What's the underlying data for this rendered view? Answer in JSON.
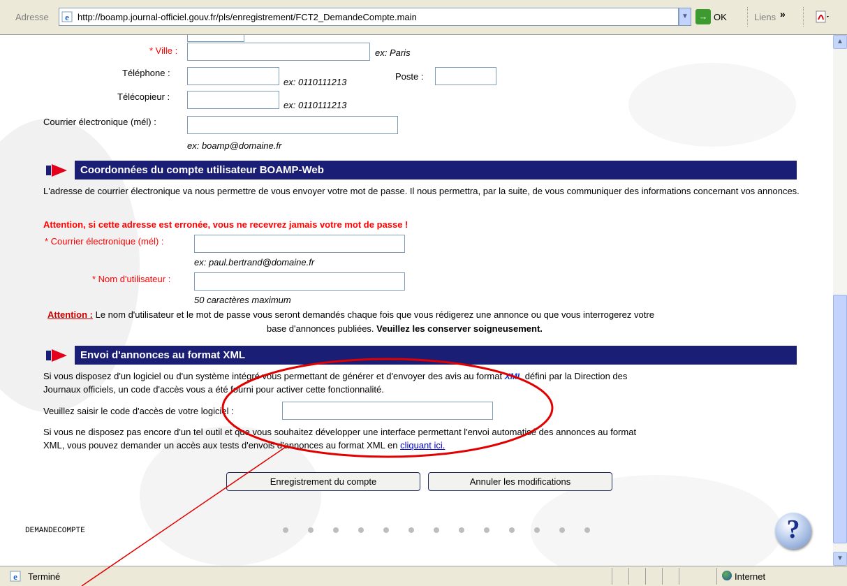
{
  "browser": {
    "address_label": "Adresse",
    "url": "http://boamp.journal-officiel.gouv.fr/pls/enregistrement/FCT2_DemandeCompte.main",
    "go_label": "OK",
    "links_label": "Liens",
    "links_chevron": "»",
    "status_text": "Terminé",
    "zone_text": "Internet"
  },
  "address_section": {
    "ville_label": "* Ville :",
    "ville_example": "ex: Paris",
    "telephone_label": "Téléphone :",
    "telephone_example": "ex: 0110111213",
    "poste_label": "Poste :",
    "telecopieur_label": "Télécopieur :",
    "telecopieur_example": "ex: 0110111213",
    "mel_label": "Courrier électronique (mél) :",
    "mel_example": "ex: boamp@domaine.fr"
  },
  "account_section": {
    "title": "Coordonnées du compte utilisateur BOAMP-Web",
    "intro": "L'adresse de courrier électronique va nous permettre de vous envoyer votre mot de passe. Il nous permettra, par la suite, de vous communiquer des informations concernant vos annonces.",
    "warning": "Attention, si cette adresse est erronée, vous ne recevrez jamais votre mot de passe !",
    "mel_label": "* Courrier électronique (mél) :",
    "mel_example": "ex: paul.bertrand@domaine.fr",
    "username_label": "* Nom d'utilisateur :",
    "username_hint": "50 caractères maximum",
    "attention_label": "Attention :",
    "attention_text_line1": "Le nom d'utilisateur et le mot de passe vous seront demandés chaque fois que vous rédigerez une annonce ou que vous interrogerez votre",
    "attention_text_line2": "base d'annonces publiées.",
    "attention_bold": "Veuillez les conserver soigneusement."
  },
  "xml_section": {
    "title": "Envoi d'annonces au format XML",
    "intro_line1_a": "Si vous disposez d'un logiciel ou d'un système intégré vous permettant de générer et d'envoyer des avis au format",
    "xml_logo": "XML",
    "intro_line1_b": "défini par la Direction des",
    "intro_line2": "Journaux officiels, un code d'accès vous a été fourni pour activer cette fonctionnalité.",
    "code_label": "Veuillez saisir le code d'accès de votre logiciel :",
    "dev_line1": "Si vous ne disposez pas encore d'un tel outil et que vous souhaitez développer une interface permettant l'envoi automatisé des annonces au format",
    "dev_line2": "XML, vous pouvez demander un accès aux tests d'envois d'annonces au format XML en",
    "dev_link": "cliquant ici."
  },
  "actions": {
    "save_label": "Enregistrement du compte",
    "cancel_label": "Annuler les modifications"
  },
  "footer": {
    "page_id": "DEMANDECOMPTE",
    "help_label": "?"
  },
  "colors": {
    "section_bar": "#1a1f75",
    "required_red": "#ff0000",
    "annotation_red": "#e00000"
  }
}
